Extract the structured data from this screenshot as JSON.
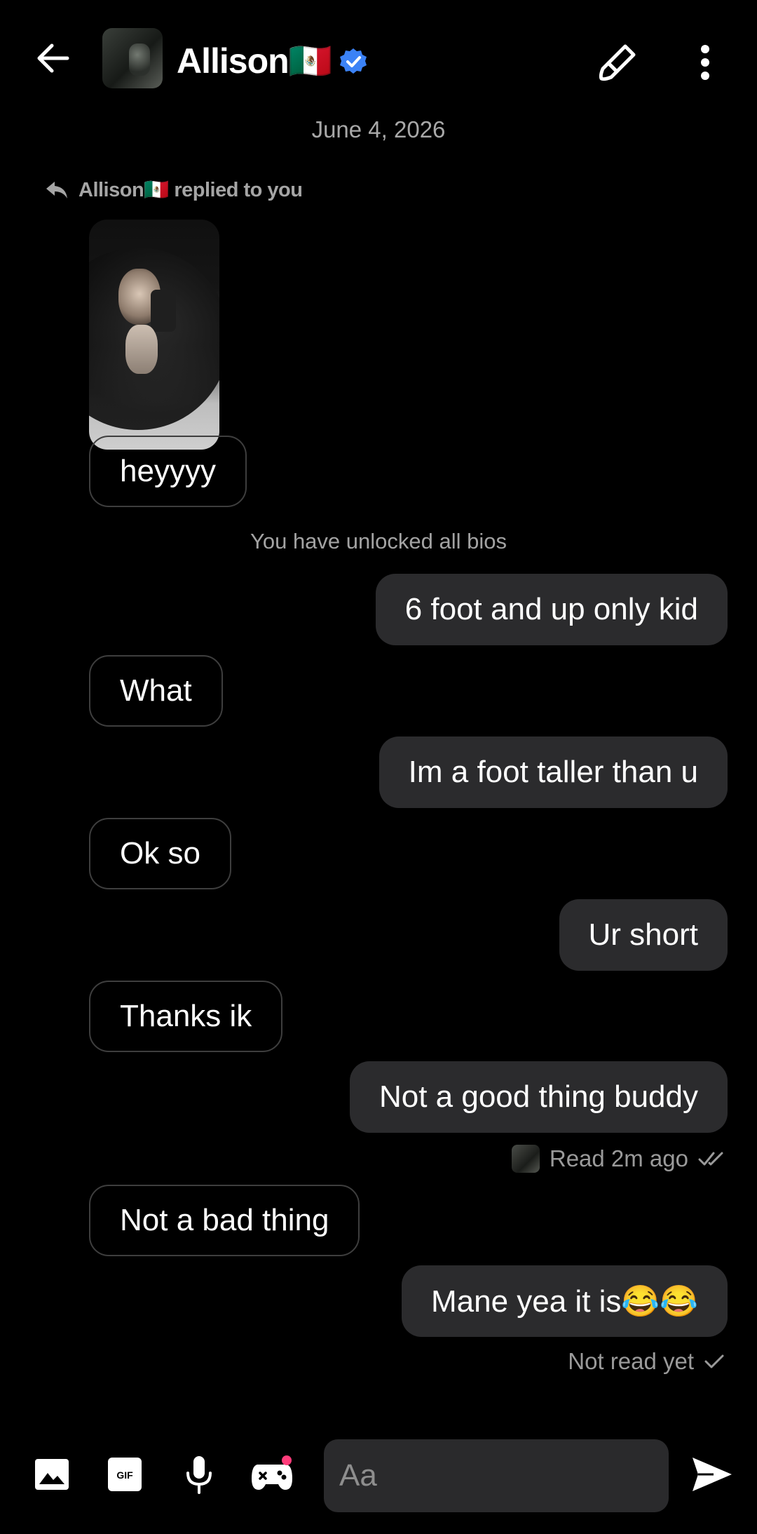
{
  "header": {
    "name": "Allison🇲🇽",
    "verified_icon": "verified-badge-icon"
  },
  "date": "June 4, 2026",
  "reply_banner": "Allison🇲🇽 replied to you",
  "messages": [
    {
      "side": "in",
      "text": "heyyyy"
    },
    {
      "side": "system",
      "text": "You have unlocked all bios"
    },
    {
      "side": "out",
      "text": "6 foot and up only kid"
    },
    {
      "side": "in",
      "text": "What"
    },
    {
      "side": "out",
      "text": "Im a foot taller than u"
    },
    {
      "side": "in",
      "text": "Ok so"
    },
    {
      "side": "out",
      "text": "Ur short"
    },
    {
      "side": "in",
      "text": "Thanks ik"
    },
    {
      "side": "out",
      "text": "Not a good thing buddy"
    },
    {
      "side": "in",
      "text": "Not a bad thing"
    },
    {
      "side": "out",
      "text": "Mane yea it is😂😂"
    }
  ],
  "receipts": {
    "read": "Read 2m ago",
    "not_read": "Not read yet"
  },
  "composer": {
    "placeholder": "Aa"
  },
  "colors": {
    "background": "#000000",
    "outgoing_bubble": "#2b2b2d",
    "incoming_border": "#3e3e3e",
    "verified": "#3b82f6",
    "notification_dot": "#ff3c7a"
  }
}
